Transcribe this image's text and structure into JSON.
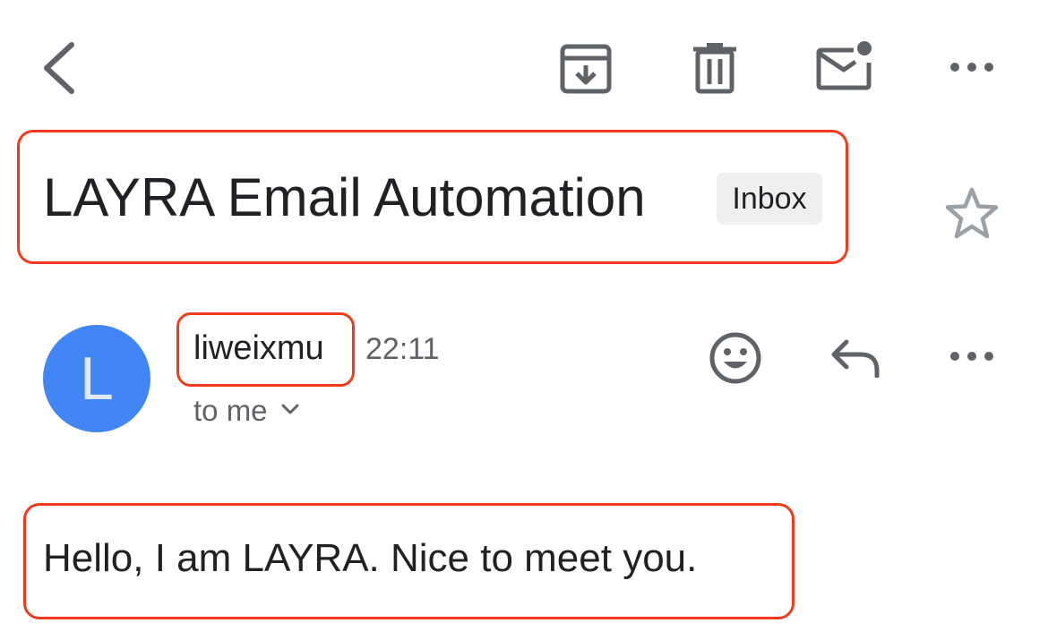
{
  "toolbar": {
    "icons": {
      "back": "chevron-left-icon",
      "archive": "archive-icon",
      "delete": "trash-icon",
      "mark_unread": "mail-unread-icon",
      "more": "more-horizontal-icon"
    }
  },
  "subject": {
    "title": "LAYRA Email Automation",
    "label": "Inbox",
    "star_icon": "star-outline-icon"
  },
  "message": {
    "avatar_initial": "L",
    "sender": "liweixmu",
    "time": "22:11",
    "recipient": "to me",
    "icons": {
      "react": "emoji-icon",
      "reply": "reply-icon",
      "more": "more-horizontal-icon"
    },
    "body": "Hello, I am LAYRA. Nice to meet you."
  },
  "colors": {
    "highlight": "#f23a1c",
    "avatar": "#4285f4",
    "icon": "#5f6368",
    "text": "#202124",
    "badge_bg": "#efefef"
  }
}
